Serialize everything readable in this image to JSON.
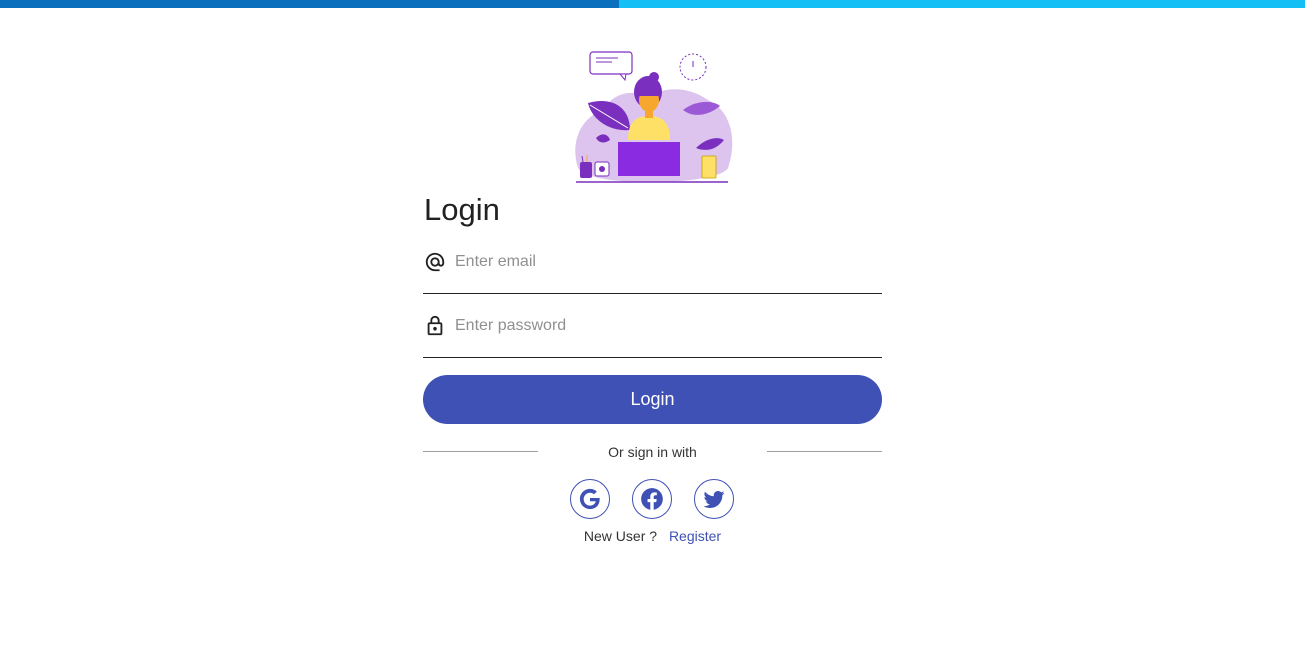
{
  "progress": {
    "fraction": 0.474
  },
  "form": {
    "title": "Login",
    "email": {
      "placeholder": "Enter email",
      "value": "",
      "icon": "at-icon"
    },
    "password": {
      "placeholder": "Enter password",
      "value": "",
      "icon": "lock-icon"
    },
    "submit_label": "Login",
    "divider_text": "Or sign in with",
    "social": [
      {
        "name": "google",
        "icon": "google-icon"
      },
      {
        "name": "facebook",
        "icon": "facebook-icon"
      },
      {
        "name": "twitter",
        "icon": "twitter-icon"
      }
    ],
    "register_prompt": "New User ?",
    "register_link": "Register"
  },
  "colors": {
    "primary": "#3f51b5",
    "progress_fill": "#0a6fbd",
    "progress_track": "#14bff5",
    "illustration_purple": "#8a2be2"
  }
}
